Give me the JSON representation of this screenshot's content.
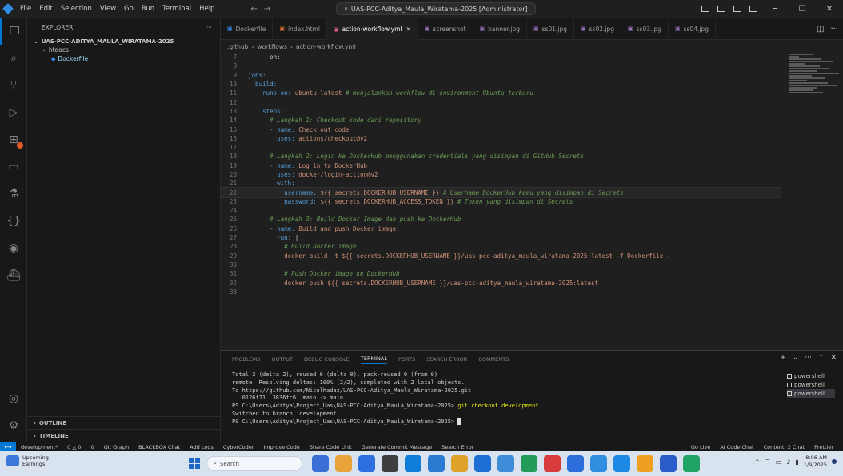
{
  "window": {
    "title": "UAS-PCC-Aditya_Maula_Wiratama-2025 [Administrator]",
    "menu": [
      "File",
      "Edit",
      "Selection",
      "View",
      "Go",
      "Run",
      "Terminal",
      "Help"
    ]
  },
  "sidebar": {
    "header": "EXPLORER",
    "root": "UAS-PCC-ADITYA_MAULA_WIRATAMA-2025",
    "folder": "htdocs",
    "file": "Dockerfile",
    "outline": "OUTLINE",
    "timeline": "TIMELINE"
  },
  "tabs": [
    {
      "label": "Dockerfile",
      "active": false
    },
    {
      "label": "index.html",
      "active": false
    },
    {
      "label": "action-workflow.yml",
      "active": true
    },
    {
      "label": "screenshot",
      "active": false
    },
    {
      "label": "banner.jpg",
      "active": false
    },
    {
      "label": "ss01.jpg",
      "active": false
    },
    {
      "label": "ss02.jpg",
      "active": false
    },
    {
      "label": "ss03.jpg",
      "active": false
    },
    {
      "label": "ss04.jpg",
      "active": false
    }
  ],
  "breadcrumb": [
    ".github",
    "workflows",
    "action-workflow.yml"
  ],
  "editor": {
    "lines": [
      {
        "n": "7",
        "parts": [
          {
            "t": "      on:",
            "c": "v"
          }
        ]
      },
      {
        "n": "8",
        "parts": [
          {
            "t": "",
            "c": "v"
          }
        ]
      },
      {
        "n": "9",
        "parts": [
          {
            "t": "jobs:",
            "c": "k"
          }
        ]
      },
      {
        "n": "10",
        "parts": [
          {
            "t": "  build:",
            "c": "k"
          }
        ]
      },
      {
        "n": "11",
        "parts": [
          {
            "t": "    runs-on: ",
            "c": "k"
          },
          {
            "t": "ubuntu-latest ",
            "c": "s"
          },
          {
            "t": "# menjalankan workflow di environment Ubuntu terbaru",
            "c": "c"
          }
        ]
      },
      {
        "n": "12",
        "parts": [
          {
            "t": "",
            "c": "v"
          }
        ]
      },
      {
        "n": "13",
        "parts": [
          {
            "t": "    steps:",
            "c": "k"
          }
        ]
      },
      {
        "n": "14",
        "parts": [
          {
            "t": "      # Langkah 1: Checkout kode dari repository",
            "c": "c"
          }
        ]
      },
      {
        "n": "15",
        "parts": [
          {
            "t": "      - name: ",
            "c": "k"
          },
          {
            "t": "Check out code",
            "c": "s"
          }
        ]
      },
      {
        "n": "16",
        "parts": [
          {
            "t": "        uses: ",
            "c": "k"
          },
          {
            "t": "actions/checkout@v2",
            "c": "s"
          }
        ]
      },
      {
        "n": "17",
        "parts": [
          {
            "t": "",
            "c": "v"
          }
        ]
      },
      {
        "n": "18",
        "parts": [
          {
            "t": "      # Langkah 2: Login ke DockerHub menggunakan credentials yang disimpan di GitHub Secrets",
            "c": "c"
          }
        ]
      },
      {
        "n": "19",
        "parts": [
          {
            "t": "      - name: ",
            "c": "k"
          },
          {
            "t": "Log in to DockerHub",
            "c": "s"
          }
        ]
      },
      {
        "n": "20",
        "parts": [
          {
            "t": "        uses: ",
            "c": "k"
          },
          {
            "t": "docker/login-action@v2",
            "c": "s"
          }
        ]
      },
      {
        "n": "21",
        "parts": [
          {
            "t": "        with:",
            "c": "k"
          }
        ]
      },
      {
        "n": "22",
        "parts": [
          {
            "t": "          username: ",
            "c": "k"
          },
          {
            "t": "${{ secrets.DOCKERHUB_USERNAME }} ",
            "c": "s"
          },
          {
            "t": "# Username DockerHub kamu yang disimpan di Secrets",
            "c": "c"
          }
        ],
        "current": true
      },
      {
        "n": "23",
        "parts": [
          {
            "t": "          password: ",
            "c": "k"
          },
          {
            "t": "${{ secrets.DOCKERHUB_ACCESS_TOKEN }} ",
            "c": "s"
          },
          {
            "t": "# Token yang disimpan di Secrets",
            "c": "c"
          }
        ]
      },
      {
        "n": "24",
        "parts": [
          {
            "t": "",
            "c": "v"
          }
        ]
      },
      {
        "n": "25",
        "parts": [
          {
            "t": "      # Langkah 3: Build Docker Image dan push ke DockerHub",
            "c": "c"
          }
        ]
      },
      {
        "n": "26",
        "parts": [
          {
            "t": "      - name: ",
            "c": "k"
          },
          {
            "t": "Build and push Docker image",
            "c": "s"
          }
        ]
      },
      {
        "n": "27",
        "parts": [
          {
            "t": "        run: ",
            "c": "k"
          },
          {
            "t": "|",
            "c": "v"
          }
        ]
      },
      {
        "n": "28",
        "parts": [
          {
            "t": "          # Build Docker image",
            "c": "c"
          }
        ]
      },
      {
        "n": "29",
        "parts": [
          {
            "t": "          docker build -t ${{ secrets.DOCKERHUB_USERNAME }}/uas-pcc-aditya_maula_wiratama-2025:latest -f Dockerfile .",
            "c": "s"
          }
        ]
      },
      {
        "n": "30",
        "parts": [
          {
            "t": "",
            "c": "v"
          }
        ]
      },
      {
        "n": "31",
        "parts": [
          {
            "t": "          # Push Docker image ke DockerHub",
            "c": "c"
          }
        ]
      },
      {
        "n": "32",
        "parts": [
          {
            "t": "          docker push ${{ secrets.DOCKERHUB_USERNAME }}/uas-pcc-aditya_maula_wiratama-2025:latest",
            "c": "s"
          }
        ]
      },
      {
        "n": "33",
        "parts": [
          {
            "t": "",
            "c": "v"
          }
        ]
      }
    ]
  },
  "panel": {
    "tabs": [
      {
        "label": "PROBLEMS",
        "active": false
      },
      {
        "label": "OUTPUT",
        "active": false
      },
      {
        "label": "DEBUG CONSOLE",
        "active": false
      },
      {
        "label": "TERMINAL",
        "active": true
      },
      {
        "label": "PORTS",
        "active": false
      },
      {
        "label": "SEARCH ERROR",
        "active": false
      },
      {
        "label": "COMMENTS",
        "active": false
      }
    ],
    "terminal_lines": [
      {
        "t": "Total 3 (delta 2), reused 0 (delta 0), pack-reused 0 (from 0)",
        "cmd": ""
      },
      {
        "t": "remote: Resolving deltas: 100% (2/2), completed with 2 local objects.",
        "cmd": ""
      },
      {
        "t": "To https://github.com/Nicolhadaz/UAS-PCC-Aditya_Maula_Wiratama-2025.git",
        "cmd": ""
      },
      {
        "t": "   0126f71..3836fc6  main -> main",
        "cmd": ""
      },
      {
        "t": "PS C:\\Users\\Aditya\\Project_Uas\\UAS-PCC-Aditya_Maula_Wiratama-2025> ",
        "cmd": "git checkout development"
      },
      {
        "t": "Switched to branch 'development'",
        "cmd": ""
      },
      {
        "t": "PS C:\\Users\\Aditya\\Project_Uas\\UAS-PCC-Aditya_Maula_Wiratama-2025> ",
        "cmd": "",
        "cursor": true
      }
    ],
    "terminals": [
      {
        "label": "powershell",
        "active": false
      },
      {
        "label": "powershell",
        "active": false
      },
      {
        "label": "powershell",
        "active": true
      }
    ]
  },
  "statusbar": {
    "left": [
      "development*",
      "0 △ 0",
      "0",
      "Git Graph",
      "BLACKBOX Chat",
      "Add Logs",
      "CyberCoder",
      "Improve Code",
      "Share Code Link",
      "Generate Commit Message",
      "Search Error"
    ],
    "right": [
      "Go Live",
      "AI Code Chat",
      "Content: 2 Chat",
      "Prettier"
    ]
  },
  "taskbar": {
    "weather_title": "Upcoming",
    "weather_sub": "Earnings",
    "search_placeholder": "Search",
    "time": "8:06 AM",
    "date": "1/9/2025",
    "apps": [
      "#3b6fd6",
      "#e8a33a",
      "#2e6fe0",
      "#3f3f3f",
      "#0f7dd8",
      "#2b7bd2",
      "#e0a12a",
      "#1d6fd5",
      "#3f8dd9",
      "#239c5a",
      "#d83b3b",
      "#2c6ed9",
      "#2f8ee0",
      "#1e88e5",
      "#f0a020",
      "#2b5cc9",
      "#21a366"
    ]
  }
}
